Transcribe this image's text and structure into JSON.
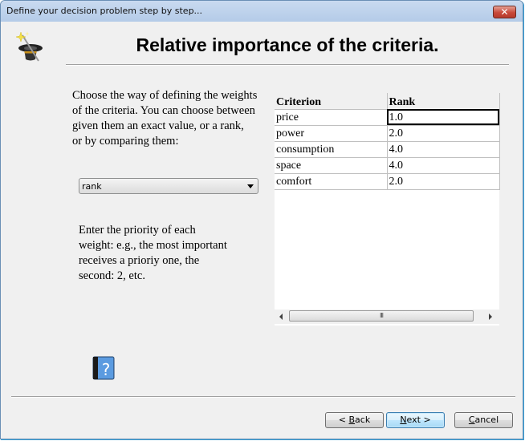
{
  "window": {
    "title": "Define your decision problem step by step...",
    "close_glyph": "✕"
  },
  "header": {
    "icon": "magic-hat-wand-icon",
    "title": "Relative importance of the criteria."
  },
  "left": {
    "intro_lines": [
      "Choose the way of defining the weights",
      "of the criteria. You can choose between",
      "given them an exact value, or a rank,",
      "or by comparing them:"
    ],
    "method_select": {
      "value": "rank"
    },
    "hint_lines": [
      "Enter the priority of each",
      "weight: e.g., the most important",
      "receives a prioriy one, the",
      "second: 2, etc."
    ],
    "help_icon": "help-book-icon"
  },
  "table": {
    "columns": [
      "Criterion",
      "Rank"
    ],
    "rows": [
      {
        "criterion": "price",
        "rank": "1.0"
      },
      {
        "criterion": "power",
        "rank": "2.0"
      },
      {
        "criterion": "consumption",
        "rank": "4.0"
      },
      {
        "criterion": "space",
        "rank": "4.0"
      },
      {
        "criterion": "comfort",
        "rank": "2.0"
      }
    ],
    "scroll_thumb_grip": "III"
  },
  "footer": {
    "back_prefix": "< ",
    "back_mnemonic": "B",
    "back_rest": "ack",
    "next_mnemonic": "N",
    "next_rest": "ext >",
    "cancel_mnemonic": "C",
    "cancel_rest": "ancel"
  }
}
